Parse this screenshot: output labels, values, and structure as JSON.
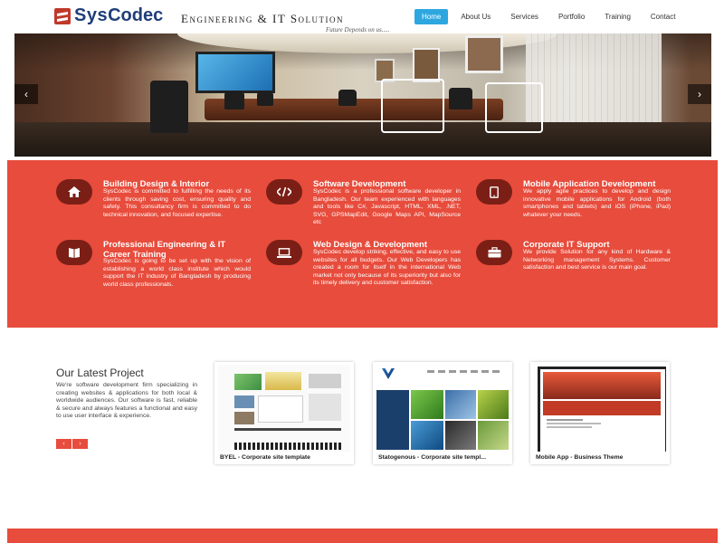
{
  "logo": {
    "brand_part1": "Sys",
    "brand_part2": "Codec",
    "tagline": "Engineering & IT Solution",
    "subtitle": "Future Depends on us....."
  },
  "nav": {
    "items": [
      "Home",
      "About Us",
      "Services",
      "Portfolio",
      "Training",
      "Contact"
    ],
    "active": "Home"
  },
  "hero": {
    "prev_label": "‹",
    "next_label": "›"
  },
  "services": [
    {
      "icon": "home-icon",
      "title": "Building Design & Interior",
      "text": "SysCodec is committed to fulfilling the needs of its clients through saving cost, ensuring quality and safety. This consultancy firm is committed to do technical innovation, and focused expertise."
    },
    {
      "icon": "code-icon",
      "title": "Software Development",
      "text": "SysCodec is a professional software developer in Bangladesh. Our team experienced with languages and tools like C#, Javascript, HTML, XML, .NET, SVG, GPSMapEdit, Google Maps API, MapSource etc"
    },
    {
      "icon": "tablet-icon",
      "title": "Mobile Application Development",
      "text": "We apply agile practices to develop and design innovative mobile applications for Android (both smartphones and tablets) and iOS (iPhone, iPad) whatever your needs."
    },
    {
      "icon": "book-icon",
      "title": "Professional Engineering & IT Career Training",
      "text": "SysCodec is going to be set up with the vision of establishing a world class institute which would support the IT industry of Bangladesh by producing world class professionals."
    },
    {
      "icon": "laptop-icon",
      "title": "Web Design & Development",
      "text": "SysCodec develop striking, effective, and easy to use websites for all budgets. Our Web Developers has created a room for itself in the international Web market not only because of its superiority but also for its timely delivery and customer satisfaction."
    },
    {
      "icon": "briefcase-icon",
      "title": "Corporate IT Support",
      "text": "We provide Solution for any kind of Hardware & Networking management Systems. Customer satisfaction and best service is our main goal."
    }
  ],
  "latest_project": {
    "title": "Our Latest Project",
    "text": "We're software development firm specializing in creating websites & applications for both local & worldwide audiences. Our software is fast, reliable & secure and always features a functional and easy to use user interface & experience.",
    "prev_label": "‹",
    "next_label": "›"
  },
  "projects": [
    {
      "caption": "BYEL - Corporate site template"
    },
    {
      "caption": "Statogenous - Corporate site templ..."
    },
    {
      "caption": "Mobile App - Business Theme"
    }
  ],
  "colors": {
    "accent": "#e74c3c",
    "icon_circle": "#7b1f16",
    "nav_active": "#2ea7e0",
    "brand": "#1f3f78"
  }
}
